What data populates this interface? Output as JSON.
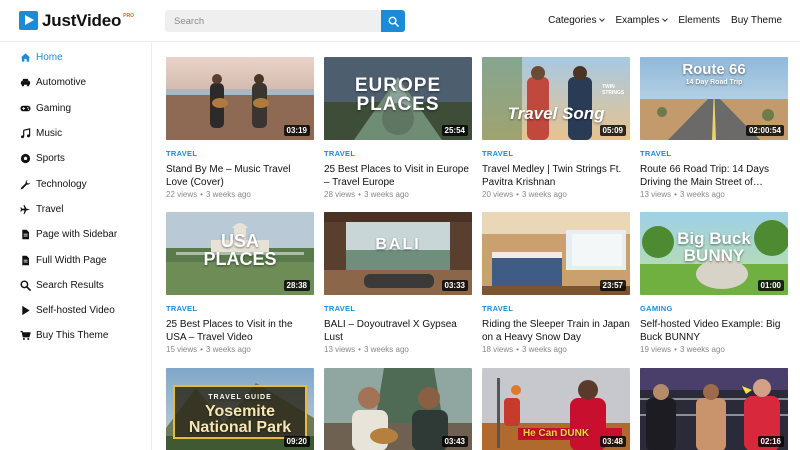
{
  "brand": {
    "name": "JustVideo",
    "badge": "PRO"
  },
  "search": {
    "placeholder": "Search"
  },
  "topnav": [
    {
      "label": "Categories",
      "dropdown": true
    },
    {
      "label": "Examples",
      "dropdown": true
    },
    {
      "label": "Elements",
      "dropdown": false
    },
    {
      "label": "Buy Theme",
      "dropdown": false
    }
  ],
  "sidebar": [
    {
      "label": "Home",
      "icon": "home-icon",
      "active": true
    },
    {
      "label": "Automotive",
      "icon": "car-icon"
    },
    {
      "label": "Gaming",
      "icon": "gamepad-icon"
    },
    {
      "label": "Music",
      "icon": "music-note-icon"
    },
    {
      "label": "Sports",
      "icon": "soccer-ball-icon"
    },
    {
      "label": "Technology",
      "icon": "wrench-icon"
    },
    {
      "label": "Travel",
      "icon": "plane-icon"
    },
    {
      "label": "Page with Sidebar",
      "icon": "document-icon"
    },
    {
      "label": "Full Width Page",
      "icon": "document-icon"
    },
    {
      "label": "Search Results",
      "icon": "search-icon"
    },
    {
      "label": "Self-hosted Video",
      "icon": "play-icon"
    },
    {
      "label": "Buy This Theme",
      "icon": "cart-icon"
    }
  ],
  "videos": [
    {
      "category": "TRAVEL",
      "title": "Stand By Me – Music Travel Love (Cover)",
      "views": "22 views",
      "age": "3 weeks ago",
      "duration": "03:19",
      "overlay": ""
    },
    {
      "category": "TRAVEL",
      "title": "25 Best Places to Visit in Europe – Travel Europe",
      "views": "28 views",
      "age": "3 weeks ago",
      "duration": "25:54",
      "overlay": "EUROPE PLACES"
    },
    {
      "category": "TRAVEL",
      "title": "Travel Medley | Twin Strings Ft. Pavitra Krishnan",
      "views": "20 views",
      "age": "3 weeks ago",
      "duration": "05:09",
      "overlay": "Travel Song"
    },
    {
      "category": "TRAVEL",
      "title": "Route 66 Road Trip: 14 Days Driving the Main Street of…",
      "views": "13 views",
      "age": "3 weeks ago",
      "duration": "02:00:54",
      "overlay": "Route 66"
    },
    {
      "category": "TRAVEL",
      "title": "25 Best Places to Visit in the USA – Travel Video",
      "views": "15 views",
      "age": "3 weeks ago",
      "duration": "28:38",
      "overlay": "USA PLACES"
    },
    {
      "category": "TRAVEL",
      "title": "BALI – Doyoutravel X Gypsea Lust",
      "views": "13 views",
      "age": "3 weeks ago",
      "duration": "03:33",
      "overlay": "BALI"
    },
    {
      "category": "TRAVEL",
      "title": "Riding the Sleeper Train in Japan on a Heavy Snow Day",
      "views": "18 views",
      "age": "3 weeks ago",
      "duration": "23:57",
      "overlay": ""
    },
    {
      "category": "GAMING",
      "title": "Self-hosted Video Example: Big Buck BUNNY",
      "views": "19 views",
      "age": "3 weeks ago",
      "duration": "01:00",
      "overlay": "Big Buck BUNNY"
    },
    {
      "category": "",
      "title": "",
      "views": "",
      "age": "",
      "duration": "09:20",
      "overlay": "Yosemite National Park"
    },
    {
      "category": "",
      "title": "",
      "views": "",
      "age": "",
      "duration": "03:43",
      "overlay": ""
    },
    {
      "category": "",
      "title": "",
      "views": "",
      "age": "",
      "duration": "03:48",
      "overlay": "He Can DUNK"
    },
    {
      "category": "",
      "title": "",
      "views": "",
      "age": "",
      "duration": "02:16",
      "overlay": ""
    }
  ],
  "overlay_extras": {
    "route66_sub": "14 Day Road Trip",
    "twin_strings": "TWIN STRINGS",
    "travel_guide": "TRAVEL GUIDE"
  },
  "colors": {
    "accent": "#1b8bd8",
    "badge": "#e85c2d"
  }
}
